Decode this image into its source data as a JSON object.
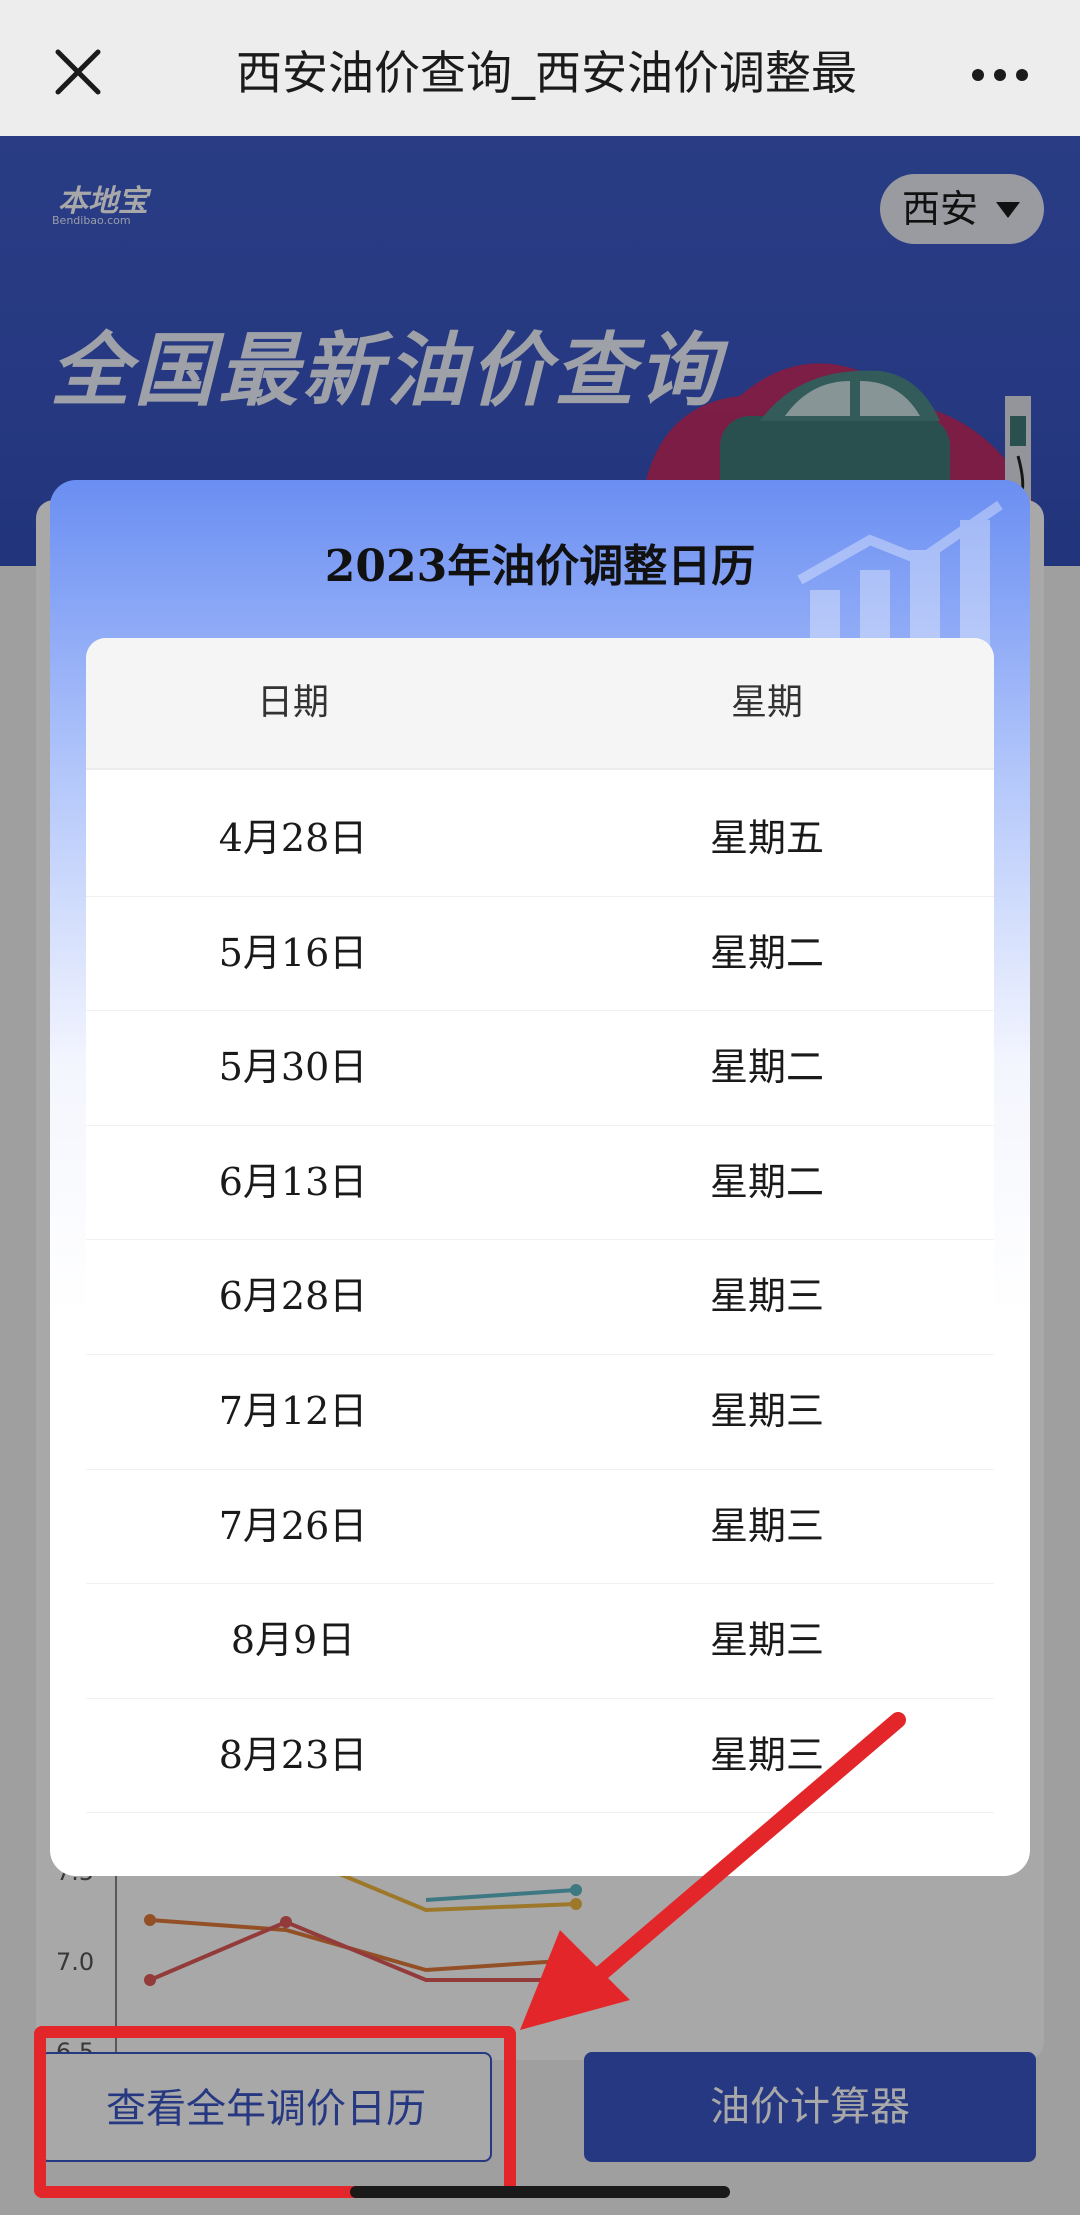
{
  "topbar": {
    "title": "西安油价查询_西安油价调整最",
    "close_icon": "close-icon",
    "more_icon": "more-icon"
  },
  "banner": {
    "logo_text": "本地宝",
    "logo_sub": "Bendibao.com",
    "city": "西安",
    "headline": "全国最新油价查询"
  },
  "modal": {
    "title": "2023年油价调整日历",
    "columns": [
      "日期",
      "星期"
    ],
    "rows": [
      {
        "date": "4月28日",
        "weekday": "星期五"
      },
      {
        "date": "5月16日",
        "weekday": "星期二"
      },
      {
        "date": "5月30日",
        "weekday": "星期二"
      },
      {
        "date": "6月13日",
        "weekday": "星期二"
      },
      {
        "date": "6月28日",
        "weekday": "星期三"
      },
      {
        "date": "7月12日",
        "weekday": "星期三"
      },
      {
        "date": "7月26日",
        "weekday": "星期三"
      },
      {
        "date": "8月9日",
        "weekday": "星期三"
      },
      {
        "date": "8月23日",
        "weekday": "星期三"
      }
    ]
  },
  "background_chart": {
    "y_ticks": [
      "7.5",
      "7.0",
      "6.5"
    ]
  },
  "bottom_buttons": {
    "left": "查看全年调价日历",
    "right": "油价计算器"
  },
  "colors": {
    "brand": "#3a56c4",
    "annotation": "#e3262a"
  }
}
